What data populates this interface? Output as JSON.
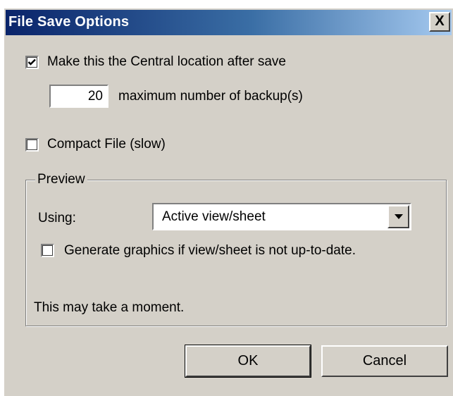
{
  "window": {
    "title": "File Save Options",
    "close_glyph": "X"
  },
  "options": {
    "central_location": {
      "label": "Make this the Central location after save",
      "checked": true
    },
    "max_backups": {
      "value": "20",
      "label": "maximum number of backup(s)"
    },
    "compact_file": {
      "label": "Compact File (slow)",
      "checked": false
    }
  },
  "preview": {
    "group_label": "Preview",
    "using_label": "Using:",
    "using_selected": "Active view/sheet",
    "generate_graphics": {
      "label": "Generate graphics if view/sheet is not up-to-date.",
      "checked": false
    },
    "note": "This may take a moment."
  },
  "buttons": {
    "ok_label": "OK",
    "cancel_label": "Cancel"
  },
  "icons": {
    "close": "close-icon",
    "checkmark": "checkmark-icon",
    "dropdown": "chevron-down-icon"
  }
}
